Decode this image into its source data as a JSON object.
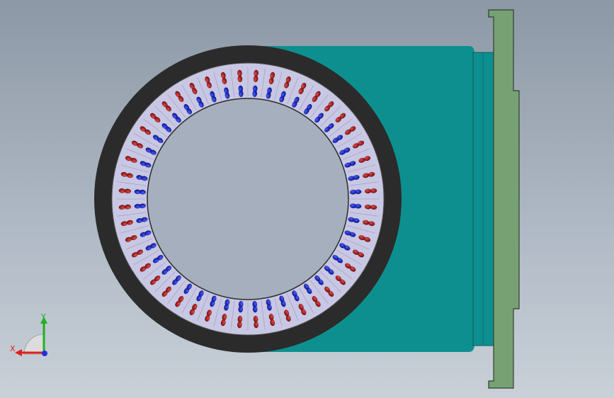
{
  "viewport": {
    "background_top": "#8d98a6",
    "background_bottom": "#c9d0d8"
  },
  "model": {
    "housing_color": "#0e8f8f",
    "housing_shade": "#0a7676",
    "flange_color": "#77a173",
    "flange_outline": "#2f3f2f",
    "outer_ring_color": "#2b2b2b",
    "stator_color": "#c8c8e4",
    "bore_color": "#a5afbd",
    "outer_winding_color": "#b01818",
    "inner_winding_color": "#1c28d8",
    "slot_count": 48
  },
  "triad": {
    "x_label": "X",
    "y_label": "Y",
    "x_color": "#e02020",
    "y_color": "#20b020",
    "z_color": "#2030e0",
    "icon": "coordinate-triad-icon"
  }
}
